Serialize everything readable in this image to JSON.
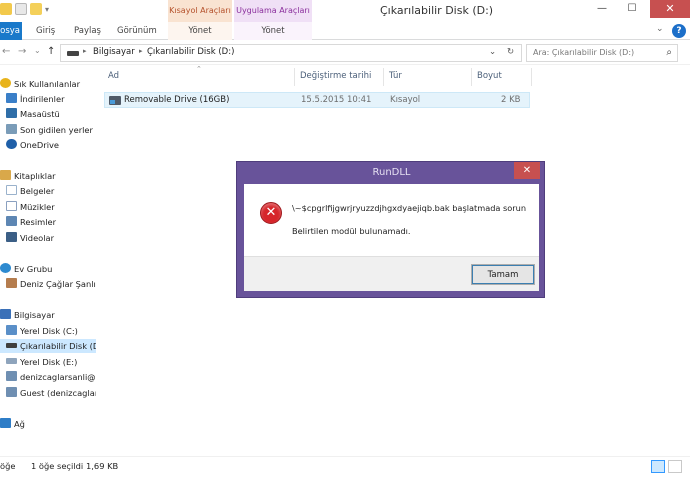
{
  "window": {
    "title": "Çıkarılabilir Disk (D:)",
    "context_groups": [
      "Kısayol Araçları",
      "Uygulama Araçları"
    ],
    "controls": {
      "minimize": "—",
      "maximize": "☐",
      "close": "✕"
    }
  },
  "ribbon": {
    "tabs": [
      "osya",
      "Giriş",
      "Paylaş",
      "Görünüm"
    ],
    "context_tabs": [
      "Yönet",
      "Yönet"
    ],
    "expand": "⌄",
    "help": "?"
  },
  "address": {
    "back": "←",
    "forward": "→",
    "history": "⌄",
    "up": "↑",
    "crumbs": [
      "Bilgisayar",
      "Çıkarılabilir Disk (D:)"
    ],
    "crumb_sep": "▸",
    "dropdown": "⌄",
    "refresh": "↻",
    "search_placeholder": "Ara: Çıkarılabilir Disk (D:)",
    "search_icon": "⌕"
  },
  "nav": {
    "items": [
      {
        "label": "Sık Kullanılanlar",
        "icon": "star-icon",
        "color": "#e8b31b"
      },
      {
        "label": "İndirilenler",
        "icon": "downloads-folder-icon",
        "color": "#3a7fc8"
      },
      {
        "label": "Masaüstü",
        "icon": "desktop-icon",
        "color": "#2f6ea8"
      },
      {
        "label": "Son gidilen yerler",
        "icon": "recent-places-icon",
        "color": "#7a9cb8"
      },
      {
        "label": "OneDrive",
        "icon": "cloud-icon",
        "color": "#1f5fa8"
      },
      {
        "label": "Kitaplıklar",
        "icon": "libraries-icon",
        "color": "#d9a84a"
      },
      {
        "label": "Belgeler",
        "icon": "documents-icon",
        "color": "#9ab2cc"
      },
      {
        "label": "Müzikler",
        "icon": "music-icon",
        "color": "#8aa0c0"
      },
      {
        "label": "Resimler",
        "icon": "pictures-icon",
        "color": "#5d86b3"
      },
      {
        "label": "Videolar",
        "icon": "videos-icon",
        "color": "#3c5f86"
      },
      {
        "label": "Ev Grubu",
        "icon": "homegroup-icon",
        "color": "#2d8ad0"
      },
      {
        "label": "Deniz Çağlar Şanlı",
        "icon": "user-icon",
        "color": "#b57d4e"
      },
      {
        "label": "Bilgisayar",
        "icon": "computer-icon",
        "color": "#3a70b8"
      },
      {
        "label": "Yerel Disk (C:)",
        "icon": "system-drive-icon",
        "color": "#5a8fc8"
      },
      {
        "label": "Çıkarılabilir Disk (D:)",
        "icon": "removable-drive-icon",
        "color": "#3f3f3f"
      },
      {
        "label": "Yerel Disk (E:)",
        "icon": "local-drive-icon",
        "color": "#8ea4bc"
      },
      {
        "label": "denizcaglarsanli@h",
        "icon": "network-user-icon",
        "color": "#6f8fb2"
      },
      {
        "label": "Guest (denizcaglar",
        "icon": "network-user-icon",
        "color": "#6f8fb2"
      },
      {
        "label": "Ağ",
        "icon": "network-icon",
        "color": "#2e7dc7"
      }
    ]
  },
  "files": {
    "columns": [
      "Ad",
      "Değiştirme tarihi",
      "Tür",
      "Boyut"
    ],
    "sort_indicator": "⌃",
    "rows": [
      {
        "name": "Removable Drive (16GB)",
        "date": "15.5.2015 10:41",
        "type": "Kısayol",
        "size": "2 KB"
      }
    ]
  },
  "status": {
    "item_count": "öğe",
    "selected": "1 öğe seçildi",
    "size": "1,69 KB"
  },
  "dialog": {
    "title": "RunDLL",
    "close": "✕",
    "icon": "error-icon",
    "icon_glyph": "✕",
    "message_line1": "\\~$cpgrlfijgwrjryuzzdjhgxdyaejiqb.bak başlatmada sorun",
    "message_line2": "Belirtilen modül bulunamadı.",
    "ok_label": "Tamam"
  },
  "colors": {
    "accent": "#1979ca",
    "dialog_frame": "#68539a",
    "close_red": "#c75050",
    "selection": "#e5f3fb"
  }
}
